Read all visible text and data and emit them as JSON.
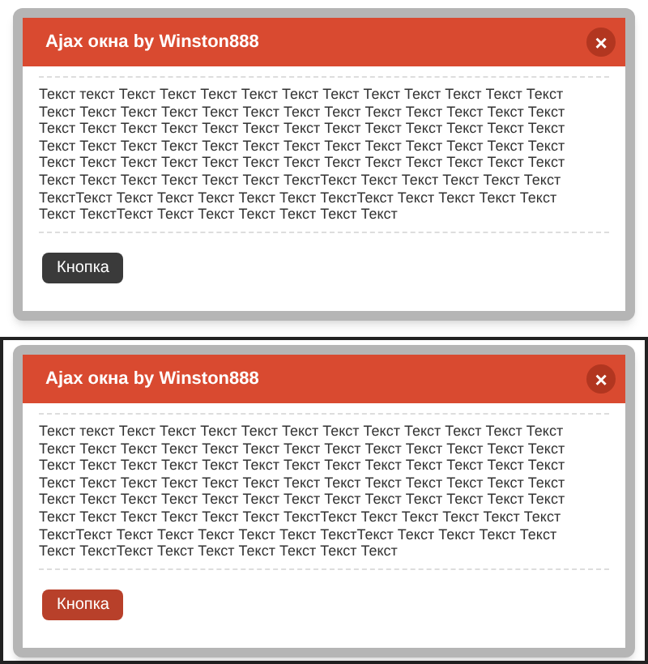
{
  "dialogs": [
    {
      "title": "Ajax окна by Winston888",
      "close": "×",
      "framed": false,
      "lines": [
        "Текст текст Текст Текст Текст Текст Текст Текст Текст Текст Текст Текст Текст",
        "Текст Текст Текст Текст Текст Текст Текст Текст Текст Текст Текст Текст Текст",
        "Текст Текст Текст Текст Текст Текст Текст Текст Текст Текст Текст Текст Текст",
        "Текст Текст Текст Текст Текст Текст Текст Текст Текст Текст Текст Текст Текст",
        "Текст Текст Текст Текст Текст Текст Текст Текст Текст Текст Текст Текст Текст",
        "Текст Текст Текст Текст Текст Текст ТекстТекст Текст Текст Текст Текст Текст",
        "ТекстТекст Текст Текст Текст Текст Текст ТекстТекст Текст Текст Текст Текст",
        "Текст ТекстТекст Текст Текст Текст Текст Текст Текст"
      ],
      "button": {
        "label": "Кнопка",
        "highlighted": false
      }
    },
    {
      "title": "Ajax окна by Winston888",
      "close": "×",
      "framed": true,
      "lines": [
        "Текст текст Текст Текст Текст Текст Текст Текст Текст Текст Текст Текст Текст",
        "Текст Текст Текст Текст Текст Текст Текст Текст Текст Текст Текст Текст Текст",
        "Текст Текст Текст Текст Текст Текст Текст Текст Текст Текст Текст Текст Текст",
        "Текст Текст Текст Текст Текст Текст Текст Текст Текст Текст Текст Текст Текст",
        "Текст Текст Текст Текст Текст Текст Текст Текст Текст Текст Текст Текст Текст",
        "Текст Текст Текст Текст Текст Текст ТекстТекст Текст Текст Текст Текст Текст",
        "ТекстТекст Текст Текст Текст Текст Текст ТекстТекст Текст Текст Текст Текст",
        "Текст ТекстТекст Текст Текст Текст Текст Текст Текст"
      ],
      "button": {
        "label": "Кнопка",
        "highlighted": true
      }
    }
  ]
}
